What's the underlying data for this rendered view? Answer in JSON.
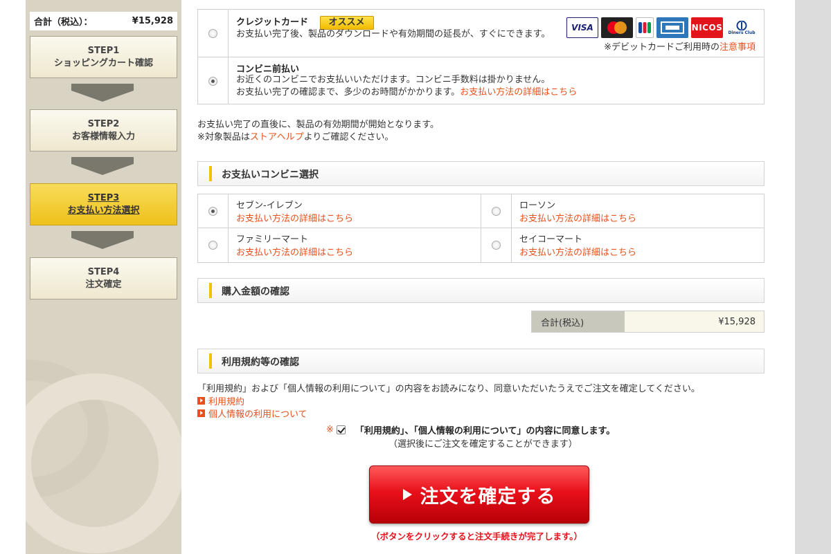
{
  "sidebar": {
    "total_label": "合計（税込）：",
    "total_value": "¥15,928",
    "steps": [
      {
        "line1": "STEP1",
        "line2": "ショッピングカート確認"
      },
      {
        "line1": "STEP2",
        "line2": "お客様情報入力"
      },
      {
        "line1": "STEP3",
        "line2": "お支払い方法選択"
      },
      {
        "line1": "STEP4",
        "line2": "注文確定"
      }
    ],
    "active_step": 3
  },
  "payment": {
    "credit": {
      "title": "クレジットカード",
      "badge": "オススメ",
      "desc": "お支払い完了後、製品のダウンロードや有効期間の延長が、すぐにできます。",
      "cards": [
        "VISA",
        "MasterCard",
        "JCB",
        "AMEX",
        "NICOS",
        "Diners Club"
      ],
      "note_prefix": "※デビットカードご利用時の",
      "note_link": "注意事項",
      "selected": false
    },
    "convenience": {
      "title": "コンビニ前払い",
      "desc1": "お近くのコンビニでお支払いいただけます。コンビニ手数料は掛かりません。",
      "desc2_prefix": "お支払い完了の確認まで、多少のお時間がかかります。",
      "desc2_link": "お支払い方法の詳細はこちら",
      "selected": true
    }
  },
  "notes": {
    "line1": "お支払い完了の直後に、製品の有効期間が開始となります。",
    "line2_prefix": "※対象製品は",
    "line2_link": "ストアヘルプ",
    "line2_suffix": "よりご確認ください。"
  },
  "store_section": {
    "title": "お支払いコンビニ選択",
    "stores": [
      {
        "name": "セブン-イレブン",
        "link": "お支払い方法の詳細はこちら",
        "selected": true
      },
      {
        "name": "ローソン",
        "link": "お支払い方法の詳細はこちら",
        "selected": false
      },
      {
        "name": "ファミリーマート",
        "link": "お支払い方法の詳細はこちら",
        "selected": false
      },
      {
        "name": "セイコーマート",
        "link": "お支払い方法の詳細はこちら",
        "selected": false
      }
    ]
  },
  "amount_section": {
    "title": "購入金額の確認",
    "total_label": "合計(税込)",
    "total_value": "¥15,928"
  },
  "terms_section": {
    "title": "利用規約等の確認",
    "instruction": "「利用規約」および「個人情報の利用について」の内容をお読みになり、同意いただいたうえでご注文を確定してください。",
    "link_terms": "利用規約",
    "link_privacy": "個人情報の利用について",
    "required_mark": "※",
    "agree_label": "「利用規約」、「個人情報の利用について」の内容に同意します。",
    "agree_sub": "（選択後にご注文を確定することができます）",
    "agreed": true
  },
  "confirm": {
    "button_label": "注文を確定する",
    "note": "（ボタンをクリックすると注文手続きが完了します。）"
  },
  "colors": {
    "accent_orange": "#e8501c",
    "badge_yellow": "#f2c200",
    "button_red": "#e8101a",
    "sidebar_bg": "#d8d3c3"
  }
}
